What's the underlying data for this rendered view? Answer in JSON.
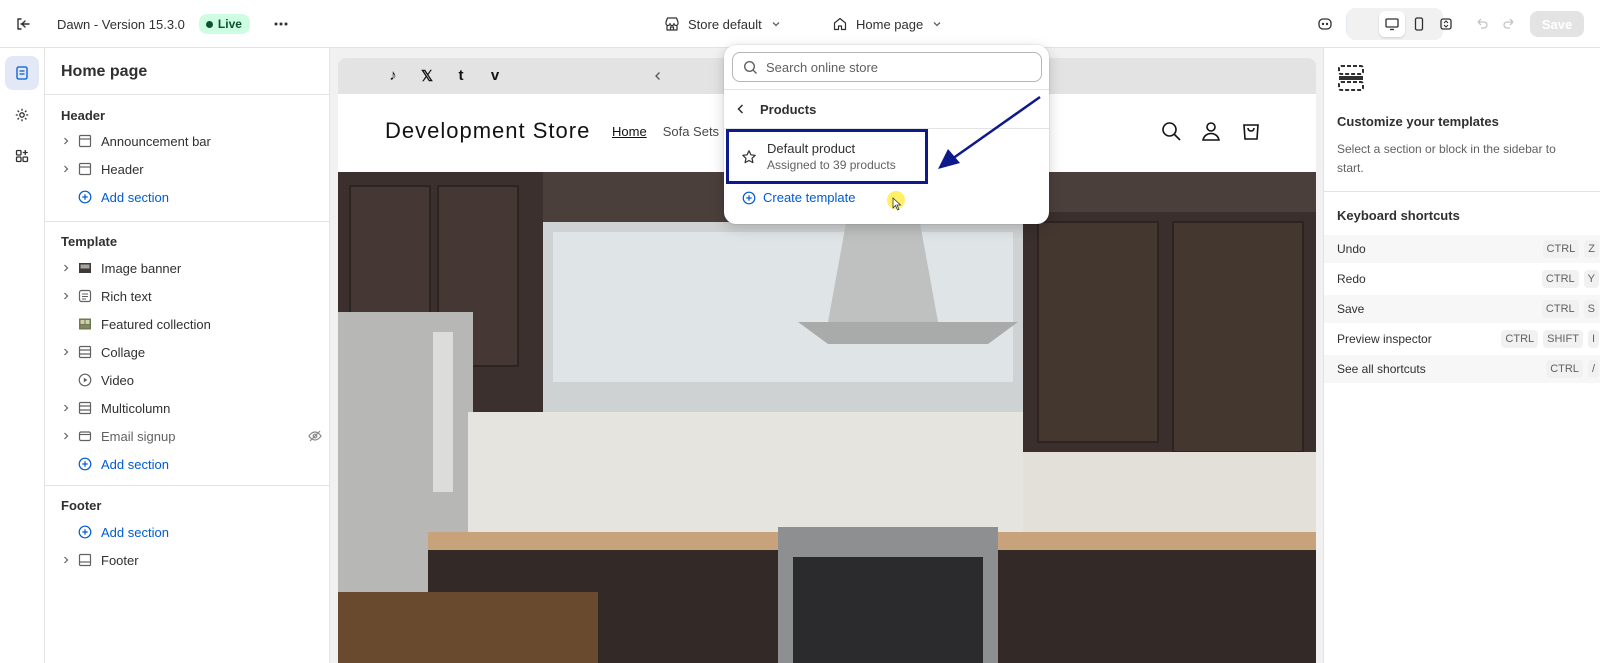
{
  "topbar": {
    "theme_name": "Dawn - Version 15.3.0",
    "live_badge": "Live",
    "store_selector": "Store default",
    "page_selector": "Home page",
    "save_label": "Save"
  },
  "sidebar": {
    "title": "Home page",
    "header_section": {
      "title": "Header",
      "items": [
        {
          "label": "Announcement bar"
        },
        {
          "label": "Header"
        }
      ],
      "add_label": "Add section"
    },
    "template_section": {
      "title": "Template",
      "items": [
        {
          "label": "Image banner"
        },
        {
          "label": "Rich text"
        },
        {
          "label": "Featured collection"
        },
        {
          "label": "Collage"
        },
        {
          "label": "Video"
        },
        {
          "label": "Multicolumn"
        },
        {
          "label": "Email signup"
        }
      ],
      "add_label": "Add section"
    },
    "footer_section": {
      "title": "Footer",
      "add_label": "Add section",
      "items": [
        {
          "label": "Footer"
        }
      ]
    }
  },
  "store_preview": {
    "social_icons": [
      "tiktok-icon",
      "x-icon",
      "tumblr-icon",
      "vimeo-icon"
    ],
    "social_glyphs": [
      "♪",
      "𝕏",
      "t",
      "v"
    ],
    "store_name": "Development Store",
    "nav": [
      "Home",
      "Sofa Sets"
    ]
  },
  "dropdown": {
    "search_placeholder": "Search online store",
    "back_label": "Products",
    "item_title": "Default product",
    "item_subtitle": "Assigned to 39 products",
    "create_label": "Create template"
  },
  "right_panel": {
    "title": "Customize your templates",
    "description": "Select a section or block in the sidebar to start.",
    "shortcuts_title": "Keyboard shortcuts",
    "shortcuts": [
      {
        "label": "Undo",
        "keys": [
          "CTRL",
          "Z"
        ]
      },
      {
        "label": "Redo",
        "keys": [
          "CTRL",
          "Y"
        ]
      },
      {
        "label": "Save",
        "keys": [
          "CTRL",
          "S"
        ]
      },
      {
        "label": "Preview inspector",
        "keys": [
          "CTRL",
          "SHIFT",
          "I"
        ]
      },
      {
        "label": "See all shortcuts",
        "keys": [
          "CTRL",
          "/"
        ]
      }
    ]
  },
  "colors": {
    "accent": "#005bd3",
    "highlight_box": "#0e1a8c",
    "live_badge_bg": "#cdfee1"
  }
}
